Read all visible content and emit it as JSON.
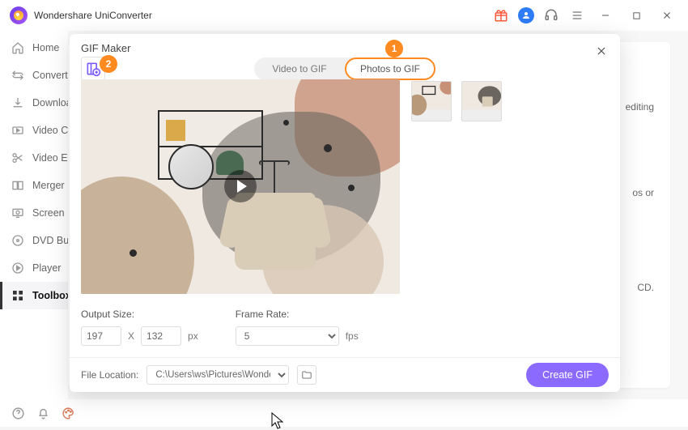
{
  "titlebar": {
    "title": "Wondershare UniConverter"
  },
  "sidebar": {
    "items": [
      {
        "label": "Home"
      },
      {
        "label": "Converter"
      },
      {
        "label": "Downloader"
      },
      {
        "label": "Video Compressor"
      },
      {
        "label": "Video Editor"
      },
      {
        "label": "Merger"
      },
      {
        "label": "Screen Recorder"
      },
      {
        "label": "DVD Burner"
      },
      {
        "label": "Player"
      },
      {
        "label": "Toolbox"
      }
    ]
  },
  "bg_panel": {
    "line1": "editing",
    "line2": "os or",
    "line3": "CD."
  },
  "dialog": {
    "title": "GIF Maker",
    "tab_video": "Video to GIF",
    "tab_photos": "Photos to GIF",
    "output_size_label": "Output Size:",
    "frame_rate_label": "Frame Rate:",
    "width_value": "197",
    "height_value": "132",
    "dim_x": "X",
    "px_label": "px",
    "fps_value": "5",
    "fps_label": "fps",
    "file_location_label": "File Location:",
    "file_location_value": "C:\\Users\\ws\\Pictures\\Wondersh",
    "create_label": "Create GIF"
  },
  "callouts": {
    "one": "1",
    "two": "2"
  }
}
